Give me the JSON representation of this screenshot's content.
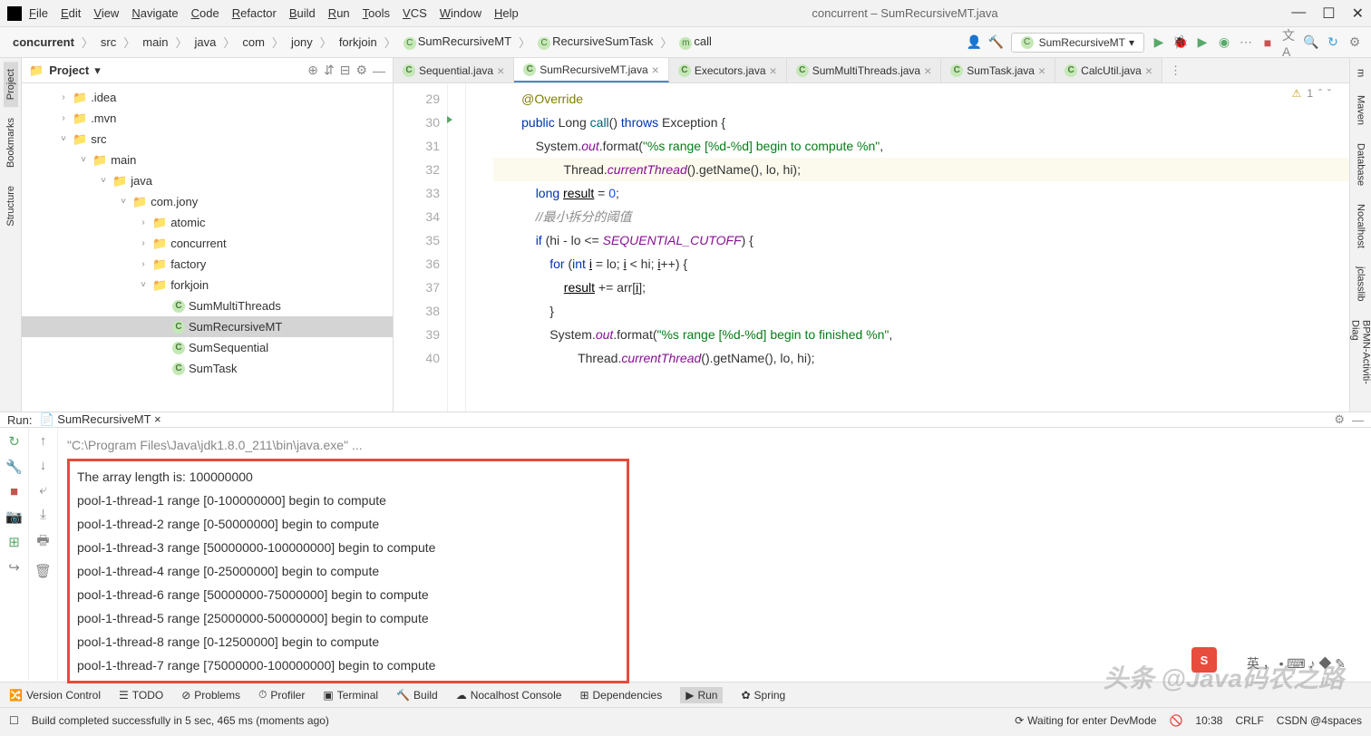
{
  "title": {
    "project": "concurrent",
    "file": "SumRecursiveMT.java"
  },
  "menus": [
    "File",
    "Edit",
    "View",
    "Navigate",
    "Code",
    "Refactor",
    "Build",
    "Run",
    "Tools",
    "VCS",
    "Window",
    "Help"
  ],
  "breadcrumbs": [
    "concurrent",
    "src",
    "main",
    "java",
    "com",
    "jony",
    "forkjoin",
    "SumRecursiveMT",
    "RecursiveSumTask",
    "call"
  ],
  "runConfig": "SumRecursiveMT",
  "projectPanel": {
    "title": "Project"
  },
  "tree": [
    {
      "indent": 0,
      "arrow": ">",
      "type": "folder",
      "name": ".idea"
    },
    {
      "indent": 0,
      "arrow": ">",
      "type": "folder",
      "name": ".mvn"
    },
    {
      "indent": 0,
      "arrow": "v",
      "type": "folder",
      "name": "src"
    },
    {
      "indent": 1,
      "arrow": "v",
      "type": "folder",
      "name": "main"
    },
    {
      "indent": 2,
      "arrow": "v",
      "type": "folder-blue",
      "name": "java"
    },
    {
      "indent": 3,
      "arrow": "v",
      "type": "folder",
      "name": "com.jony"
    },
    {
      "indent": 4,
      "arrow": ">",
      "type": "folder",
      "name": "atomic"
    },
    {
      "indent": 4,
      "arrow": ">",
      "type": "folder",
      "name": "concurrent"
    },
    {
      "indent": 4,
      "arrow": ">",
      "type": "folder",
      "name": "factory"
    },
    {
      "indent": 4,
      "arrow": "v",
      "type": "folder",
      "name": "forkjoin"
    },
    {
      "indent": 5,
      "arrow": "",
      "type": "class",
      "name": "SumMultiThreads"
    },
    {
      "indent": 5,
      "arrow": "",
      "type": "class",
      "name": "SumRecursiveMT",
      "selected": true
    },
    {
      "indent": 5,
      "arrow": "",
      "type": "class",
      "name": "SumSequential"
    },
    {
      "indent": 5,
      "arrow": "",
      "type": "class",
      "name": "SumTask"
    }
  ],
  "tabs": [
    {
      "name": "Sequential.java",
      "active": false
    },
    {
      "name": "SumRecursiveMT.java",
      "active": true
    },
    {
      "name": "Executors.java",
      "active": false
    },
    {
      "name": "SumMultiThreads.java",
      "active": false
    },
    {
      "name": "SumTask.java",
      "active": false
    },
    {
      "name": "CalcUtil.java",
      "active": false
    }
  ],
  "warnings": "1",
  "code": {
    "start": 29,
    "lines": [
      {
        "n": 29,
        "html": "<span class='ann'>@Override</span>"
      },
      {
        "n": 30,
        "html": "<span class='kw'>public</span> Long <span class='method'>call</span>() <span class='kw'>throws</span> Exception {",
        "run": true
      },
      {
        "n": 31,
        "html": "    System.<span class='field'>out</span>.format(<span class='str'>\"%s range [%d-%d] begin to compute %n\"</span>,"
      },
      {
        "n": 32,
        "html": "            Thread.<span class='field'>currentThread</span>().getName(), lo, hi);",
        "hl": true
      },
      {
        "n": 33,
        "html": "    <span class='kw'>long</span> <span class='var'>result</span> = <span class='num'>0</span>;"
      },
      {
        "n": 34,
        "html": "    <span class='comment'>//最小拆分的阈值</span>"
      },
      {
        "n": 35,
        "html": "    <span class='kw'>if</span> (hi - lo <= <span class='const'>SEQUENTIAL_CUTOFF</span>) {"
      },
      {
        "n": 36,
        "html": "        <span class='kw'>for</span> (<span class='kw'>int</span> <span class='var'>i</span> = lo; <span class='var'>i</span> < hi; <span class='var'>i</span>++) {"
      },
      {
        "n": 37,
        "html": "            <span class='var'>result</span> += arr[<span class='var'>i</span>];"
      },
      {
        "n": 38,
        "html": "        }"
      },
      {
        "n": 39,
        "html": "        System.<span class='field'>out</span>.format(<span class='str'>\"%s range [%d-%d] begin to finished %n\"</span>,"
      },
      {
        "n": 40,
        "html": "                Thread.<span class='field'>currentThread</span>().getName(), lo, hi);"
      }
    ]
  },
  "runTab": {
    "label": "Run:",
    "config": "SumRecursiveMT"
  },
  "console": {
    "cmd": "\"C:\\Program Files\\Java\\jdk1.8.0_211\\bin\\java.exe\" ...",
    "lines": [
      "The array length is: 100000000",
      "pool-1-thread-1 range [0-100000000] begin to compute",
      "pool-1-thread-2 range [0-50000000] begin to compute",
      "pool-1-thread-3 range [50000000-100000000] begin to compute",
      "pool-1-thread-4 range [0-25000000] begin to compute",
      "pool-1-thread-6 range [50000000-75000000] begin to compute",
      "pool-1-thread-5 range [25000000-50000000] begin to compute",
      "pool-1-thread-8 range [0-12500000] begin to compute",
      "pool-1-thread-7 range [75000000-100000000] begin to compute"
    ]
  },
  "bottomTools": [
    "Version Control",
    "TODO",
    "Problems",
    "Profiler",
    "Terminal",
    "Build",
    "Nocalhost Console",
    "Dependencies",
    "Run",
    "Spring"
  ],
  "status": {
    "build": "Build completed successfully in 5 sec, 465 ms (moments ago)",
    "devmode": "Waiting for enter DevMode",
    "time": "10:38",
    "eol": "CRLF",
    "csdn": "CSDN @4spaces"
  },
  "leftRail": [
    "Project",
    "Bookmarks",
    "Structure"
  ],
  "rightRail": [
    "m",
    "Maven",
    "Database",
    "Nocalhost",
    "jclasslib",
    "BPMN-Activiti-Diag"
  ],
  "watermark": "头条 @Java码农之路"
}
